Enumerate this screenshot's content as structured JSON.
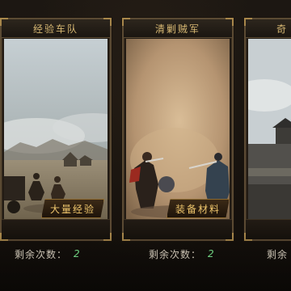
{
  "cards": [
    {
      "title": "经验车队",
      "reward": "大量经验",
      "remain_label": "剩余次数：",
      "remain_count": "2"
    },
    {
      "title": "清剿贼军",
      "reward": "装备材料",
      "remain_label": "剩余次数：",
      "remain_count": "2"
    },
    {
      "title": "奇",
      "reward": "",
      "remain_label": "剩余",
      "remain_count": ""
    }
  ],
  "colors": {
    "title": "#d7b873",
    "border": "#5b4a33",
    "reward": "#f0c76d",
    "count": "#6fd080"
  }
}
